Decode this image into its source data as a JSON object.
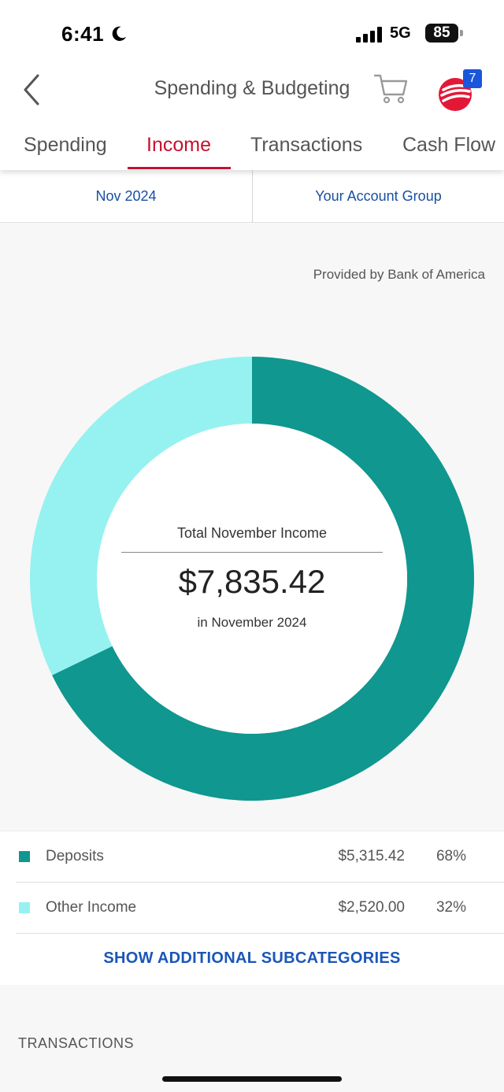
{
  "status_bar": {
    "time": "6:41",
    "network": "5G",
    "battery": "85"
  },
  "header": {
    "title": "Spending & Budgeting",
    "notification_count": "7"
  },
  "tabs": [
    {
      "label": "Spending",
      "active": false
    },
    {
      "label": "Income",
      "active": true
    },
    {
      "label": "Transactions",
      "active": false
    },
    {
      "label": "Cash Flow",
      "active": false
    }
  ],
  "filters": {
    "period": "Nov 2024",
    "account_group": "Your Account Group"
  },
  "chart": {
    "provided_by": "Provided by Bank of America",
    "center_label": "Total November Income",
    "total": "$7,835.42",
    "subtitle": "in November 2024"
  },
  "chart_data": {
    "type": "pie",
    "donut": true,
    "categories": [
      "Deposits",
      "Other Income"
    ],
    "values": [
      5315.42,
      2520.0
    ],
    "colors": [
      "#10978f",
      "#95f2f0"
    ]
  },
  "legend": {
    "items": [
      {
        "name": "Deposits",
        "amount": "$5,315.42",
        "percent": "68%",
        "color": "#10978f"
      },
      {
        "name": "Other Income",
        "amount": "$2,520.00",
        "percent": "32%",
        "color": "#95f2f0"
      }
    ],
    "show_more_label": "SHOW ADDITIONAL SUBCATEGORIES"
  },
  "transactions": {
    "section_label": "TRANSACTIONS"
  },
  "colors": {
    "accent_red": "#c8102e",
    "link_blue": "#1a56b8",
    "badge_blue": "#1a56db"
  }
}
